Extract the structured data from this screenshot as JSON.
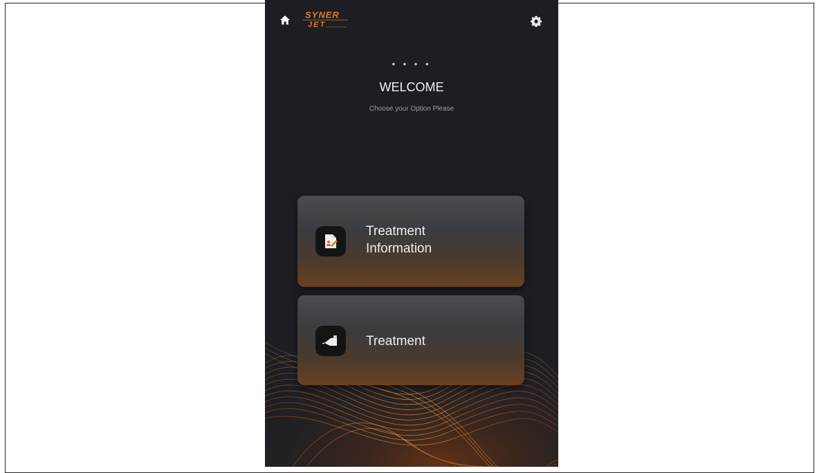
{
  "app": {
    "logo_text_top": "SYNER",
    "logo_text_bottom": "JET"
  },
  "header": {
    "dots": "• • • •",
    "title": "WELCOME",
    "subtitle": "Choose your Option Please"
  },
  "options": [
    {
      "label": "Treatment Information",
      "icon": "document-icon"
    },
    {
      "label": "Treatment",
      "icon": "handpiece-icon"
    }
  ],
  "icons": {
    "home": "home-icon",
    "settings": "gear-icon"
  },
  "colors": {
    "background": "#1c1e24",
    "accent": "#e07a1f",
    "text": "#eeeeee"
  }
}
